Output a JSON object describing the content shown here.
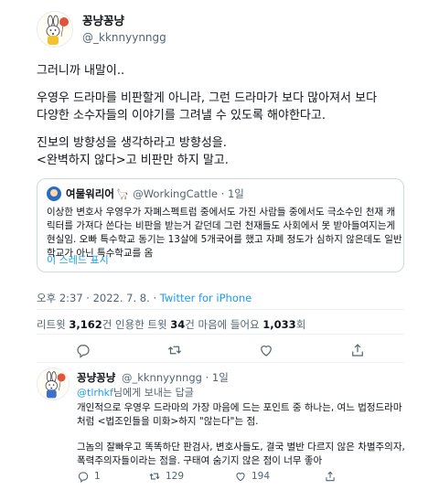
{
  "tweet": {
    "author_name": "꽁냥꽁냥",
    "author_handle": "@_kknnyynngg",
    "lines_p1": [
      "그러니까 내말이.."
    ],
    "lines_p2": [
      "우영우 드라마를 비판할게 아니라, 그런 드라마가 보다 많아져서 보다",
      "다양한 소수자들의 이야기를 그려낼 수 있도록 해야한다고."
    ],
    "lines_p3": [
      "진보의 방향성을 생각하라고 방향성을.",
      "<완벽하지 않다>고 비판만 하지 말고."
    ],
    "timestamp": "오후 2:37 · 2022. 7. 8. · ",
    "source": "Twitter for iPhone"
  },
  "quote": {
    "name": "여물워리어",
    "handle": "@WorkingCattle · 1일",
    "lines": [
      "이상한 변호사 우영우가 자폐스펙트럼 중에서도 가진 사람들 중에서도 극소수인 천재 캐",
      "릭터를 가져다 쓴다는 비판을 받는거 같던데 그런 천재들도 사회에서 못 받아들여지는게",
      "현실임. 오빠 특수학교 동기는 13살에 5개국어를 했고 자폐 정도가 심하지 않은데도 일반",
      "학교가 아닌 특수학교를 옴"
    ],
    "show_thread": "이 스레드 표시"
  },
  "stats": {
    "retweet_label": "리트윗 ",
    "retweet_count": "3,162",
    "quote_label": "건 인용한 트윗 ",
    "quote_count": "34",
    "like_label": "건 마음에 들어요 ",
    "like_count": "1,033",
    "suffix": "회"
  },
  "reply": {
    "author_name": "꽁냥꽁냥",
    "author_handle": "@_kknnyynngg · 1일",
    "reply_to_handle": "@tlrhkf",
    "reply_to_suffix": "님에게 보내는 답글",
    "lines_a": [
      "개인적으로 우영우 드라마의 가장 마음에 드는 포인트 중 하나는, 여느 법정드라마",
      "처럼 <법조인들을 미화>하지 \"않는다\"는 점."
    ],
    "lines_b": [
      "그놈의 잘빠우고 똑똑하단 판검사, 변호사들도, 결국 별반 다르지 않은 차별주의자,",
      "폭력주의자들이라는 점을. 구태여 숨기지 않은 점이 너무 좋아"
    ],
    "reply_count": "1",
    "retweet_count": "129",
    "like_count": "194"
  },
  "colors": {
    "link_blue": "#1d9bf0",
    "secondary_text": "#536471",
    "border": "#cfd9de"
  }
}
